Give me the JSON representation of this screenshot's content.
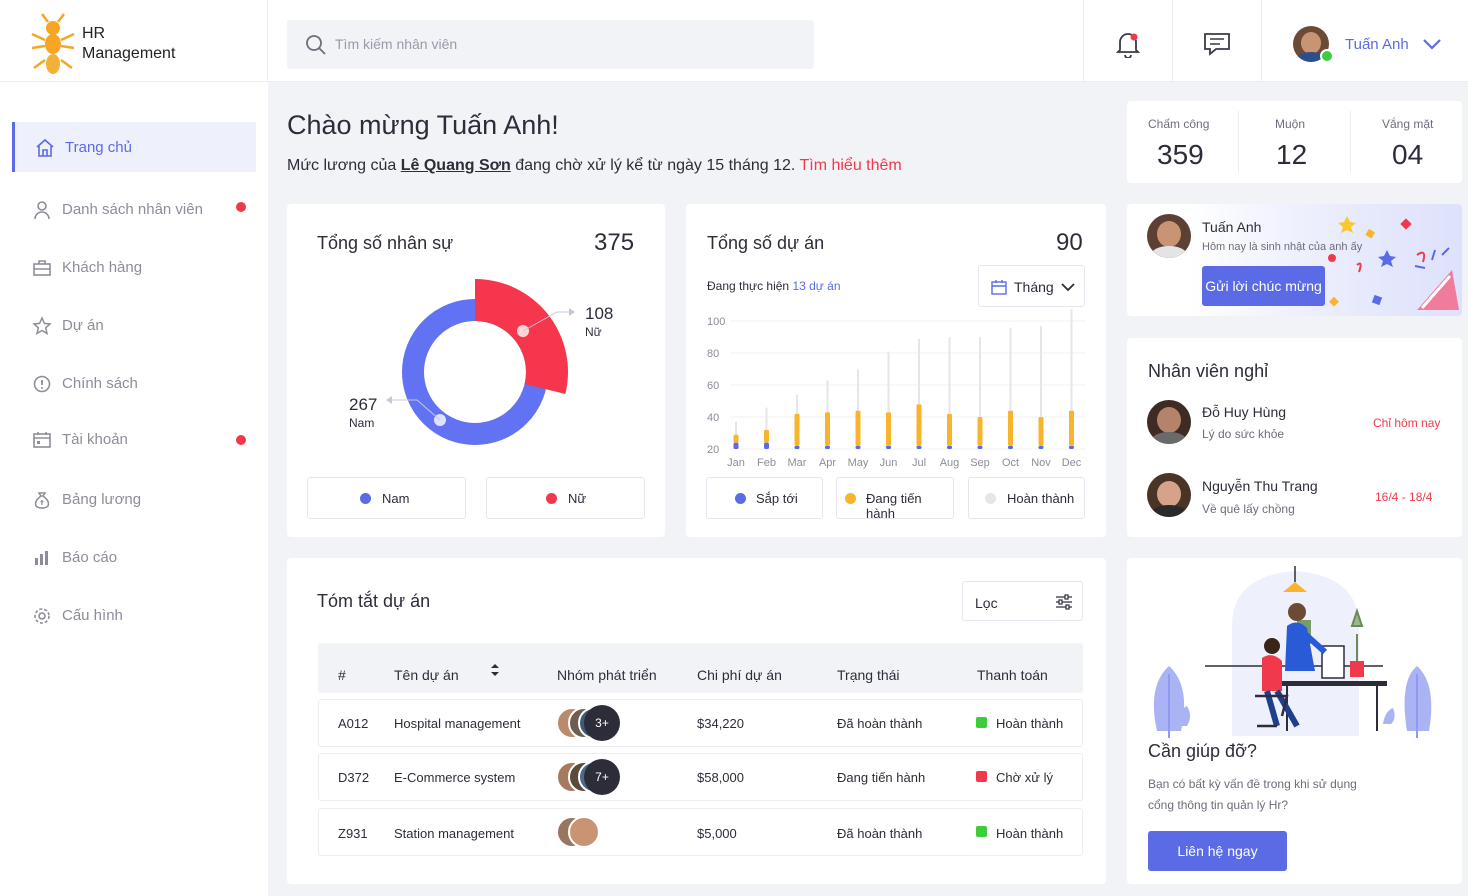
{
  "brand": {
    "line1": "HR",
    "line2": "Management"
  },
  "search": {
    "placeholder": "Tìm kiếm nhân viên"
  },
  "user": {
    "name": "Tuấn Anh"
  },
  "sidebar": {
    "items": [
      {
        "label": "Trang chủ",
        "icon": "home-icon",
        "active": true
      },
      {
        "label": "Danh sách nhân viên",
        "icon": "user-icon",
        "badge": true
      },
      {
        "label": "Khách hàng",
        "icon": "briefcase-icon"
      },
      {
        "label": "Dự án",
        "icon": "star-icon"
      },
      {
        "label": "Chính sách",
        "icon": "info-icon"
      },
      {
        "label": "Tài khoản",
        "icon": "calendar-icon",
        "badge": true
      },
      {
        "label": "Bảng lương",
        "icon": "money-bag-icon"
      },
      {
        "label": "Báo cáo",
        "icon": "bar-chart-icon"
      },
      {
        "label": "Cấu hình",
        "icon": "gear-icon"
      }
    ]
  },
  "welcome": {
    "title": "Chào mừng Tuấn Anh!",
    "msg_prefix": "Mức lương của",
    "msg_name": "Lê  Quang  Sơn",
    "msg_suffix": "đang chờ xử lý kể từ ngày 15 tháng 12.",
    "msg_link": "Tìm hiểu thêm"
  },
  "stats": [
    {
      "label": "Chấm công",
      "value": "359"
    },
    {
      "label": "Muộn",
      "value": "12"
    },
    {
      "label": "Vắng mặt",
      "value": "04"
    }
  ],
  "staff": {
    "title": "Tổng số nhân sự",
    "total": "375",
    "male_value": "267",
    "male_label": "Nam",
    "female_value": "108",
    "female_label": "Nữ",
    "legend": [
      {
        "label": "Nam",
        "color": "#5b6be6"
      },
      {
        "label": "Nữ",
        "color": "#f03a4b"
      }
    ]
  },
  "projects": {
    "title": "Tổng số dự án",
    "total": "90",
    "sub_prefix": "Đang thực hiện",
    "sub_link": "13 dự án",
    "period": "Tháng",
    "legend": [
      {
        "label": "Sắp tới",
        "color": "#5b6be6"
      },
      {
        "label": "Đang tiến hành",
        "color": "#f8b42c"
      },
      {
        "label": "Hoàn thành",
        "color": "#e6e6ea"
      }
    ]
  },
  "chart_data": {
    "type": "bar",
    "stacked": true,
    "categories": [
      "Jan",
      "Feb",
      "Mar",
      "Apr",
      "May",
      "Jun",
      "Jul",
      "Aug",
      "Sep",
      "Oct",
      "Nov",
      "Dec"
    ],
    "yticks": [
      20,
      40,
      60,
      80,
      100
    ],
    "ylim": [
      20,
      100
    ],
    "series": [
      {
        "name": "Sắp tới",
        "color": "#5b6be6",
        "values": [
          24,
          24,
          22,
          22,
          22,
          22,
          22,
          22,
          22,
          22,
          22,
          22
        ]
      },
      {
        "name": "Đang tiến hành",
        "color": "#f8b42c",
        "values": [
          5,
          8,
          20,
          21,
          22,
          21,
          26,
          20,
          18,
          22,
          18,
          22
        ]
      },
      {
        "name": "Hoàn thành",
        "color": "#e6e6ea",
        "values": [
          8,
          14,
          12,
          20,
          26,
          38,
          41,
          48,
          50,
          52,
          57,
          68
        ]
      }
    ]
  },
  "birthday": {
    "name": "Tuấn Anh",
    "msg": "Hôm nay là sinh nhật của anh ấy",
    "button": "Gửi lời chúc mừng"
  },
  "leave": {
    "title": "Nhân viên nghỉ",
    "items": [
      {
        "name": "Đỗ Huy Hùng",
        "reason": "Lý do sức khỏe",
        "when": "Chỉ hôm nay"
      },
      {
        "name": "Nguyễn Thu Trang",
        "reason": "Về quê lấy chồng",
        "when": "16/4 - 18/4"
      }
    ]
  },
  "summary": {
    "title": "Tóm tắt dự án",
    "filter": "Lọc",
    "headers": [
      "#",
      "Tên dự án",
      "Nhóm phát triển",
      "Chi phí dự án",
      "Trạng thái",
      "Thanh toán"
    ],
    "rows": [
      {
        "id": "A012",
        "name": "Hospital management",
        "team_more": "3+",
        "cost": "$34,220",
        "status": "Đã hoàn thành",
        "payment": "Hoàn thành",
        "pay_color": "#3ccc3c"
      },
      {
        "id": "D372",
        "name": "E-Commerce system",
        "team_more": "7+",
        "cost": "$58,000",
        "status": "Đang tiến hành",
        "payment": "Chờ xử lý",
        "pay_color": "#f03a4b"
      },
      {
        "id": "Z931",
        "name": "Station management",
        "team_more": "",
        "cost": "$5,000",
        "status": "Đã hoàn thành",
        "payment": "Hoàn thành",
        "pay_color": "#3ccc3c"
      }
    ]
  },
  "help": {
    "title": "Cần giúp đỡ?",
    "text1": "Bạn có bất kỳ vấn đề trong khi sử dụng",
    "text2": "cổng thông tin quản lý Hr?",
    "button": "Liên hệ ngay"
  }
}
